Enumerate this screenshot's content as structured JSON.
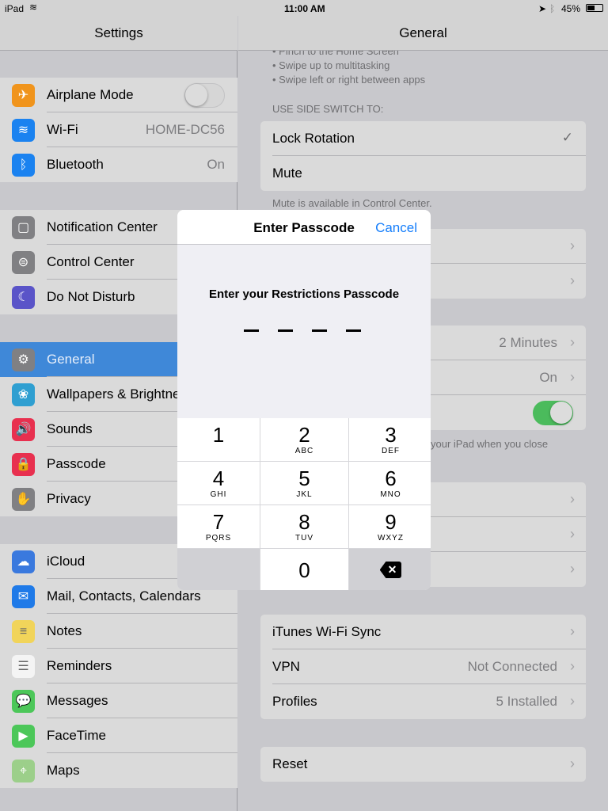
{
  "status": {
    "device": "iPad",
    "time": "11:00 AM",
    "battery": "45%"
  },
  "sidebar": {
    "title": "Settings",
    "items": [
      {
        "label": "Airplane Mode",
        "icon": "airplane-icon",
        "color": "#f0941c",
        "glyph": "✈",
        "toggle": false
      },
      {
        "label": "Wi-Fi",
        "icon": "wifi-icon",
        "color": "#1a82f0",
        "glyph": "≋",
        "value": "HOME-DC56"
      },
      {
        "label": "Bluetooth",
        "icon": "bluetooth-icon",
        "color": "#1a82f0",
        "glyph": "ᛒ",
        "value": "On"
      },
      {
        "label": "Notification Center",
        "icon": "notification-center-icon",
        "color": "#808083",
        "glyph": "▢"
      },
      {
        "label": "Control Center",
        "icon": "control-center-icon",
        "color": "#808083",
        "glyph": "⊜"
      },
      {
        "label": "Do Not Disturb",
        "icon": "moon-icon",
        "color": "#5a54c8",
        "glyph": "☾"
      },
      {
        "label": "General",
        "icon": "gear-icon",
        "color": "#808083",
        "glyph": "⚙",
        "selected": true
      },
      {
        "label": "Wallpapers & Brightness",
        "icon": "wallpaper-icon",
        "color": "#2f9fd1",
        "glyph": "❀"
      },
      {
        "label": "Sounds",
        "icon": "speaker-icon",
        "color": "#e8304f",
        "glyph": "🔊"
      },
      {
        "label": "Passcode",
        "icon": "lock-icon",
        "color": "#e8304f",
        "glyph": "🔒"
      },
      {
        "label": "Privacy",
        "icon": "hand-icon",
        "color": "#808083",
        "glyph": "✋"
      },
      {
        "label": "iCloud",
        "icon": "cloud-icon",
        "color": "#3a79de",
        "glyph": "☁"
      },
      {
        "label": "Mail, Contacts, Calendars",
        "icon": "mail-icon",
        "color": "#1f7ae8",
        "glyph": "✉"
      },
      {
        "label": "Notes",
        "icon": "notes-icon",
        "color": "#f1d45a",
        "glyph": "≡"
      },
      {
        "label": "Reminders",
        "icon": "reminders-icon",
        "color": "#f4f4f4",
        "glyph": "☰"
      },
      {
        "label": "Messages",
        "icon": "messages-icon",
        "color": "#4cc759",
        "glyph": "💬"
      },
      {
        "label": "FaceTime",
        "icon": "facetime-icon",
        "color": "#4cc759",
        "glyph": "▶"
      },
      {
        "label": "Maps",
        "icon": "maps-icon",
        "color": "#9ccf8a",
        "glyph": "⌖"
      }
    ]
  },
  "detail": {
    "title": "General",
    "gestures": [
      "• Pinch to the Home Screen",
      "• Swipe up to multitasking",
      "• Swipe left or right between apps"
    ],
    "side_switch_header": "USE SIDE SWITCH TO:",
    "side_switch": [
      {
        "label": "Lock Rotation",
        "checked": true
      },
      {
        "label": "Mute"
      }
    ],
    "mute_note": "Mute is available in Control Center.",
    "auto_lock_value": "2 Minutes",
    "restrictions_value": "On",
    "lock_unlock_on": true,
    "lock_note": "your iPad when you close",
    "network": [
      {
        "label": "iTunes Wi-Fi Sync"
      },
      {
        "label": "VPN",
        "value": "Not Connected"
      },
      {
        "label": "Profiles",
        "value": "5 Installed"
      }
    ],
    "reset": "Reset"
  },
  "modal": {
    "title": "Enter Passcode",
    "cancel": "Cancel",
    "prompt": "Enter your Restrictions Passcode",
    "keys": [
      {
        "d": "1",
        "l": ""
      },
      {
        "d": "2",
        "l": "ABC"
      },
      {
        "d": "3",
        "l": "DEF"
      },
      {
        "d": "4",
        "l": "GHI"
      },
      {
        "d": "5",
        "l": "JKL"
      },
      {
        "d": "6",
        "l": "MNO"
      },
      {
        "d": "7",
        "l": "PQRS"
      },
      {
        "d": "8",
        "l": "TUV"
      },
      {
        "d": "9",
        "l": "WXYZ"
      },
      {
        "d": "0",
        "l": ""
      }
    ]
  }
}
